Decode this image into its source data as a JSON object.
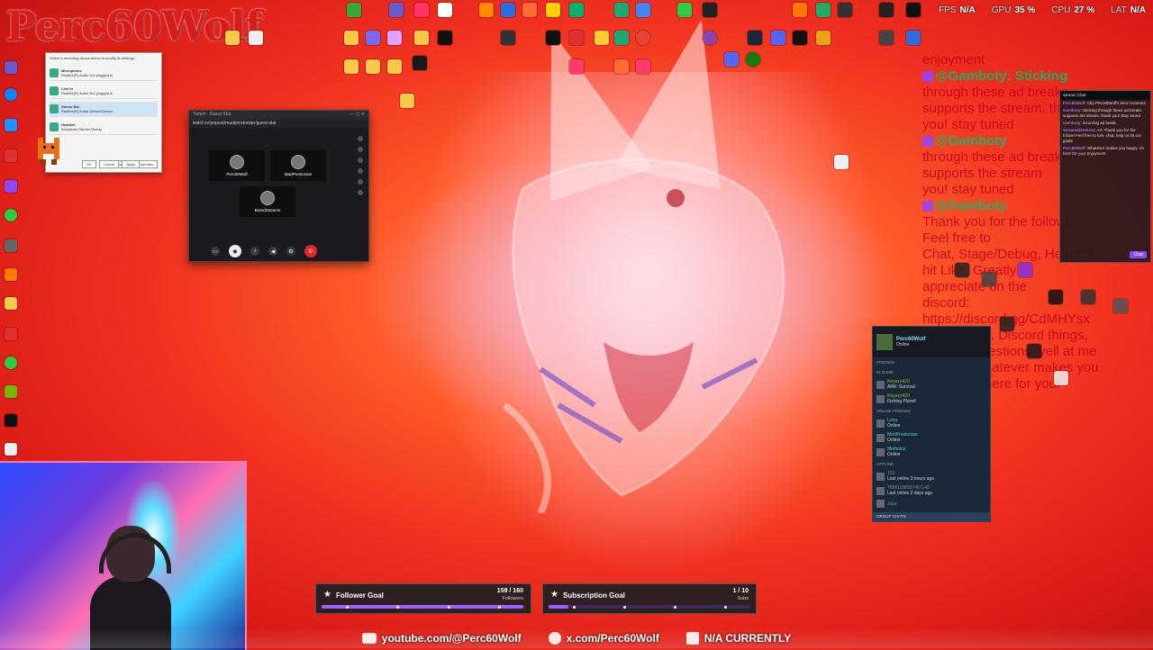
{
  "brand": {
    "logo_text": "Perc60Wolf"
  },
  "hud": {
    "fps_label": "FPS",
    "fps_value": "N/A",
    "gpu_label": "GPU",
    "gpu_value": "35 %",
    "cpu_label": "CPU",
    "cpu_value": "27 %",
    "lat_label": "LAT",
    "lat_value": "N/A"
  },
  "guest_window": {
    "title": "Twitch - Guest Star",
    "url": "twitch.tv/popout/madprestonian/guest-star",
    "guests": [
      "Perc60Wolf",
      "MadPrestonian",
      "BoredStreams"
    ]
  },
  "sound_dialog": {
    "header": "Select a recording device below to modify its settings:",
    "devices": [
      {
        "name": "Microphone",
        "sub": "Realtek(R) Audio",
        "status": "Not plugged in"
      },
      {
        "name": "Line In",
        "sub": "Realtek(R) Audio",
        "status": "Not plugged in"
      },
      {
        "name": "Stereo Mix",
        "sub": "Realtek(R) Audio",
        "status": "Default Device"
      },
      {
        "name": "Headset",
        "sub": "Broadcast Stream",
        "status": "Ready"
      }
    ],
    "buttons": [
      "Set Default",
      "Properties",
      "OK",
      "Cancel",
      "Apply"
    ]
  },
  "chat_overlay": {
    "lines": [
      "enjoyment",
      "@Gamboty: Sticking",
      "through these ad breaks",
      "supports the stream. thank",
      "you! stay tuned",
      "@Gamboty",
      "through these ad breaks",
      "supports the stream",
      "you! stay tuned",
      "@Gamboty",
      "Thank you for the follow!",
      "Feel free to",
      "Chat, Stage/Debug, Help Us",
      "hit Like, Greatly",
      "appreciate on the",
      "discord:",
      "https://discord.gg/CdMHYsx",
      "V to Gather. Discord things,",
      "Make suggestions, yell at me",
      "directly. Whatever makes you",
      "happy. Im here for your",
      "enjoyment"
    ]
  },
  "chat_popout": {
    "header": "Stream Chat",
    "messages": [
      {
        "user": "Perc60Wolf",
        "text": "Clip Perc60Wolf's best moments"
      },
      {
        "user": "Gamboty",
        "text": "Sticking through these ad breaks supports the stream, thank you! Stay tuned"
      },
      {
        "user": "Gamboty",
        "text": "incoming ad break"
      },
      {
        "user": "StreamElements",
        "text": "AY! Thank you for the follow! Feel free to lurk, chat, help us hit our goals"
      },
      {
        "user": "Perc60Wolf",
        "text": "Whatever makes you happy. Im here for your enjoyment"
      }
    ],
    "send_label": "Chat"
  },
  "steam_friends": {
    "me_name": "Perc60Wolf",
    "me_status": "Online",
    "section_friends": "FRIENDS",
    "section_ingame": "In Game",
    "ingame": [
      {
        "name": "Keyezy420",
        "game": "ARK: Survival"
      },
      {
        "name": "Keyezy420",
        "game": "Fishing Planet"
      }
    ],
    "section_online": "Online Friends",
    "online": [
      {
        "name": "Luna",
        "status": "Online"
      },
      {
        "name": "MadPrestonian",
        "status": "Online"
      },
      {
        "name": "Metholus",
        "status": "Online"
      }
    ],
    "section_offline": "Offline",
    "offline": [
      {
        "name": "123",
        "status": "Last online 3 hours ago"
      },
      {
        "name": "76561198027467140",
        "status": "Last online 2 days ago"
      },
      {
        "name": "Jace",
        "status": ""
      }
    ],
    "group_chats": "GROUP CHATS"
  },
  "goals": {
    "follower": {
      "title": "Follower Goal",
      "count": "159 / 160",
      "unit": "Followers",
      "progress": 0.99
    },
    "sub": {
      "title": "Subscription Goal",
      "count": "1 / 10",
      "unit": "Subs",
      "progress": 0.1
    }
  },
  "social": {
    "youtube": "youtube.com/@Perc60Wolf",
    "x": "x.com/Perc60Wolf",
    "facebook": "N/A CURRENTLY"
  },
  "colors": {
    "accent": "#9146ff",
    "chat_red": "#c4001d",
    "bg_red": "#e8281a"
  }
}
